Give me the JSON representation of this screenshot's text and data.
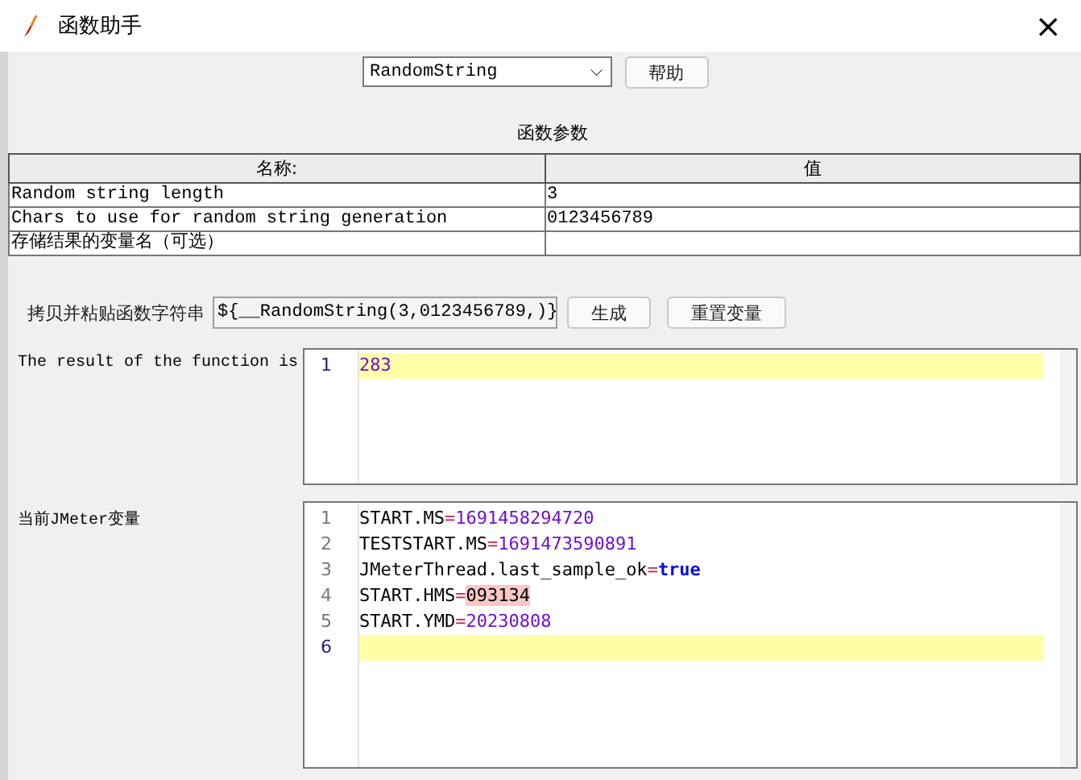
{
  "window": {
    "title": "函数助手",
    "close": "×"
  },
  "function_select": {
    "value": "RandomString",
    "caret": "⌵"
  },
  "help_button": "帮助",
  "params_title": "函数参数",
  "table": {
    "columns": [
      "名称:",
      "值"
    ],
    "rows": [
      {
        "name": "Random string length",
        "value": "3"
      },
      {
        "name": "Chars to use for random string generation",
        "value": "0123456789"
      },
      {
        "name": "存储结果的变量名（可选）",
        "value": ""
      }
    ]
  },
  "copy_label": "拷贝并粘贴函数字符串",
  "function_string": "${__RandomString(3,0123456789,)}",
  "generate_button": "生成",
  "reset_button": "重置变量",
  "result_label": "The result of the function is",
  "result_editor": {
    "lines": [
      {
        "number": "1",
        "current": true,
        "tokens": [
          {
            "text": "283",
            "kind": "number"
          }
        ]
      }
    ]
  },
  "vars_label": "当前JMeter变量",
  "vars_editor": {
    "lines": [
      {
        "number": "1",
        "current": false,
        "tokens": [
          {
            "text": "START.MS",
            "kind": "plain"
          },
          {
            "text": "=",
            "kind": "eq"
          },
          {
            "text": "1691458294720",
            "kind": "number"
          }
        ]
      },
      {
        "number": "2",
        "current": false,
        "tokens": [
          {
            "text": "TESTSTART.MS",
            "kind": "plain"
          },
          {
            "text": "=",
            "kind": "eq"
          },
          {
            "text": "1691473590891",
            "kind": "number"
          }
        ]
      },
      {
        "number": "3",
        "current": false,
        "tokens": [
          {
            "text": "JMeterThread.last_sample_ok",
            "kind": "plain"
          },
          {
            "text": "=",
            "kind": "eq"
          },
          {
            "text": "true",
            "kind": "keyword"
          }
        ]
      },
      {
        "number": "4",
        "current": false,
        "tokens": [
          {
            "text": "START.HMS",
            "kind": "plain"
          },
          {
            "text": "=",
            "kind": "eq"
          },
          {
            "text": "093134",
            "kind": "marked"
          }
        ]
      },
      {
        "number": "5",
        "current": false,
        "tokens": [
          {
            "text": "START.YMD",
            "kind": "plain"
          },
          {
            "text": "=",
            "kind": "eq"
          },
          {
            "text": "20230808",
            "kind": "number"
          }
        ]
      },
      {
        "number": "6",
        "current": true
      }
    ]
  }
}
